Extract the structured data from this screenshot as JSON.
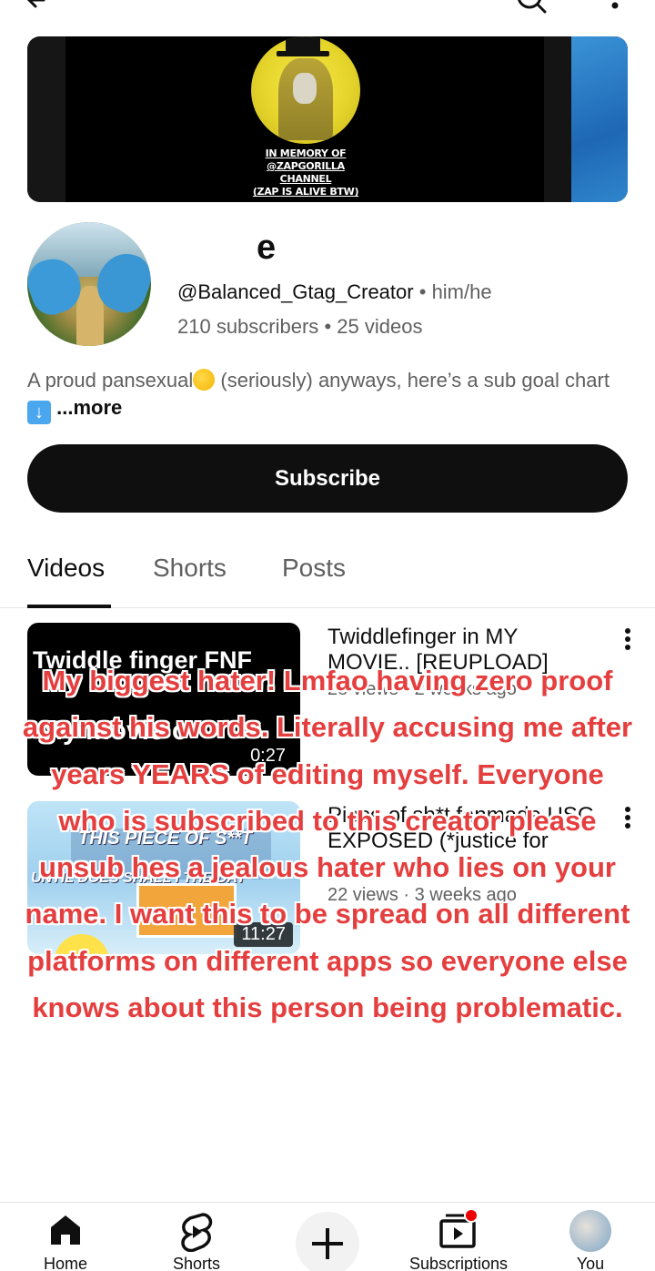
{
  "topbar": {
    "back_icon": "arrow-left-icon",
    "search_icon": "search-icon",
    "more_icon": "more-vert-icon"
  },
  "banner": {
    "memorial_text": [
      "IN MEMORY OF",
      "@ZAPGORILLA CHANNEL",
      "(ZAP IS ALIVE BTW)"
    ]
  },
  "channel": {
    "name": "e",
    "handle": "@Balanced_Gtag_Creator",
    "pronouns": "him/he",
    "subscribers": "210 subscribers",
    "videos": "25 videos",
    "separator": "•",
    "bio_part1": "A proud pansexual",
    "bio_part2": " (seriously) anyways, here’s a sub goal chart ",
    "bio_more": "...more",
    "subscribe_label": "Subscribe"
  },
  "tabs": [
    {
      "label": "Videos",
      "active": true
    },
    {
      "label": "Shorts",
      "active": false
    },
    {
      "label": "Posts",
      "active": false
    }
  ],
  "videos": [
    {
      "thumb_line1": "Twiddle finger FNF",
      "thumb_line2": "My movie c",
      "duration": "0:27",
      "title": "Twiddlefinger in MY MOVIE.. [REUPLOAD]",
      "meta": "28 views · 2 weeks ago"
    },
    {
      "thumb_line1": "THIS PIECE OF S**T",
      "thumb_line2": "UNTIL DOES SHALL I THE DAY",
      "duration": "11:27",
      "title": "Piece of sh*t fanmade USG EXPOSED (*justice for Balanced Gtag) [ENT...",
      "meta": "22 views · 3 weeks ago"
    }
  ],
  "overlay_caption": "My biggest hater! Lmfao having zero proof against his words. Literally accusing me after years YEARS of editing myself. Everyone who is subscribed to this creator please unsub hes a jealous hater who lies on your name. I want this to be spread on all different platforms on different apps so everyone else knows about this person being problematic.",
  "bottom_nav": [
    {
      "label": "Home",
      "icon": "home-icon"
    },
    {
      "label": "Shorts",
      "icon": "shorts-icon"
    },
    {
      "label": "",
      "icon": "create-plus-icon"
    },
    {
      "label": "Subscriptions",
      "icon": "subscriptions-icon"
    },
    {
      "label": "You",
      "icon": "profile-avatar"
    }
  ],
  "colors": {
    "overlay_text": "#e53e3e",
    "subscribe_bg": "#0f0f0f",
    "muted_text": "#606060"
  }
}
